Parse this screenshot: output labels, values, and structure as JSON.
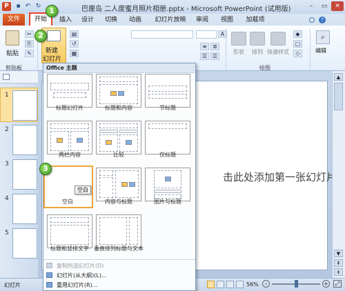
{
  "window": {
    "title": "巴厘岛 二人度蜜月照片相册.pptx - Microsoft PowerPoint (试用版)",
    "app_icon": "P"
  },
  "tabs": {
    "file": "文件",
    "home": "开始",
    "items": [
      "插入",
      "设计",
      "切换",
      "动画",
      "幻灯片放映",
      "审阅",
      "视图",
      "加载项"
    ]
  },
  "ribbon": {
    "paste": "粘贴",
    "new_slide_line1": "新建",
    "new_slide_line2": "幻灯片",
    "clipboard_group": "剪贴板",
    "drawing_group": "绘图",
    "shapes": "形状",
    "arrange": "排列",
    "quick_styles": "快速样式",
    "editing": "编辑"
  },
  "dropdown": {
    "header": "Office 主题",
    "layouts": [
      {
        "label": "标题幻灯片"
      },
      {
        "label": "标题和内容"
      },
      {
        "label": "节标题"
      },
      {
        "label": "两栏内容"
      },
      {
        "label": "比较"
      },
      {
        "label": "仅标题"
      },
      {
        "label": "空白"
      },
      {
        "label": "内容与标题"
      },
      {
        "label": "图片与标题"
      },
      {
        "label": "标题和竖排文字"
      },
      {
        "label": "垂直排列标题与文本"
      }
    ],
    "tooltip": "空白",
    "menu": {
      "duplicate": "复制所选幻灯片(D)",
      "from_outline": "幻灯片(从大纲)(L)...",
      "reuse": "重用幻灯片(R)..."
    }
  },
  "slides_panel": {
    "numbers": [
      "1",
      "2",
      "3",
      "4",
      "5"
    ]
  },
  "slide": {
    "title_text": "击此处添加第一张幻灯片"
  },
  "status": {
    "left": "幻灯片",
    "zoom": "56%"
  },
  "badges": [
    "1",
    "2",
    "3"
  ]
}
